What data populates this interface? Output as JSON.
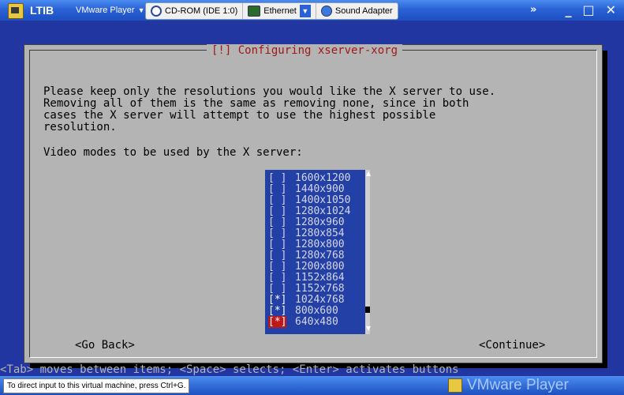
{
  "titlebar": {
    "app_title": "LTIB",
    "menu_label": "VMware Player",
    "devices": [
      {
        "label": "CD-ROM (IDE 1:0)"
      },
      {
        "label": "Ethernet"
      },
      {
        "label": "Sound Adapter"
      }
    ],
    "more_glyph": "»",
    "minimize": "_",
    "maximize": "□",
    "close": "✕"
  },
  "dialog": {
    "title": "[!] Configuring xserver-xorg",
    "paragraph": "Please keep only the resolutions you would like the X server to use.\nRemoving all of them is the same as removing none, since in both\ncases the X server will attempt to use the highest possible\nresolution.",
    "prompt": "Video modes to be used by the X server:",
    "modes": [
      {
        "mark": "[ ]",
        "label": "1600x1200"
      },
      {
        "mark": "[ ]",
        "label": "1440x900"
      },
      {
        "mark": "[ ]",
        "label": "1400x1050"
      },
      {
        "mark": "[ ]",
        "label": "1280x1024"
      },
      {
        "mark": "[ ]",
        "label": "1280x960"
      },
      {
        "mark": "[ ]",
        "label": "1280x854"
      },
      {
        "mark": "[ ]",
        "label": "1280x800"
      },
      {
        "mark": "[ ]",
        "label": "1280x768"
      },
      {
        "mark": "[ ]",
        "label": "1200x800"
      },
      {
        "mark": "[ ]",
        "label": "1152x864"
      },
      {
        "mark": "[ ]",
        "label": "1152x768"
      },
      {
        "mark": "[*]",
        "label": "1024x768"
      },
      {
        "mark": "[*]",
        "label": "800x600"
      },
      {
        "mark": "[*]",
        "label": "640x480"
      }
    ],
    "go_back": "<Go Back>",
    "continue": "<Continue>"
  },
  "hint": "<Tab> moves between items; <Space> selects; <Enter> activates buttons",
  "statusbar": {
    "message": "To direct input to this virtual machine, press Ctrl+G.",
    "brand": "VMware Player"
  },
  "colors": {
    "console_bg": "#2136a0",
    "dialog_bg": "#b4b4b4",
    "title_red": "#a01818",
    "list_bg": "#2340a6"
  }
}
